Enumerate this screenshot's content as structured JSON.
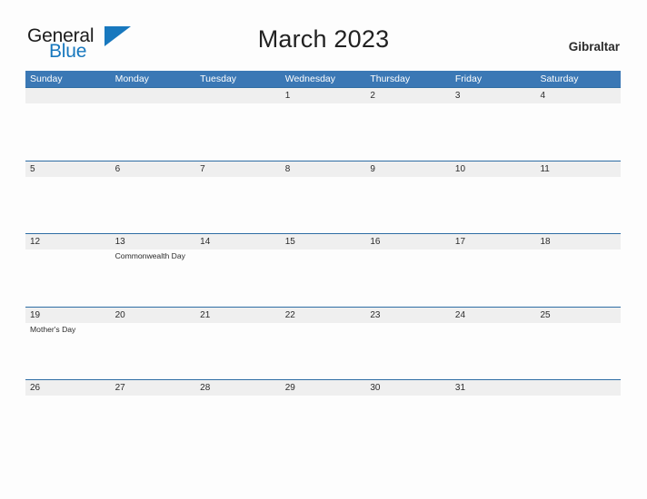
{
  "brand": {
    "name_part1": "General",
    "name_part2": "Blue",
    "flag_icon": "blue-flag-triangle-icon",
    "accent_color": "#1878be"
  },
  "header": {
    "title": "March 2023",
    "country": "Gibraltar"
  },
  "theme": {
    "header_bar_color": "#3b78b5",
    "row_divider_color": "#2e6da4",
    "date_band_color": "#efefef",
    "page_background": "#fdfdfd",
    "text_color": "#2b2b2b"
  },
  "calendar": {
    "month": "March",
    "year": "2023",
    "weekday_headers": [
      "Sunday",
      "Monday",
      "Tuesday",
      "Wednesday",
      "Thursday",
      "Friday",
      "Saturday"
    ],
    "weeks": [
      [
        {
          "day": "",
          "event": ""
        },
        {
          "day": "",
          "event": ""
        },
        {
          "day": "",
          "event": ""
        },
        {
          "day": "1",
          "event": ""
        },
        {
          "day": "2",
          "event": ""
        },
        {
          "day": "3",
          "event": ""
        },
        {
          "day": "4",
          "event": ""
        }
      ],
      [
        {
          "day": "5",
          "event": ""
        },
        {
          "day": "6",
          "event": ""
        },
        {
          "day": "7",
          "event": ""
        },
        {
          "day": "8",
          "event": ""
        },
        {
          "day": "9",
          "event": ""
        },
        {
          "day": "10",
          "event": ""
        },
        {
          "day": "11",
          "event": ""
        }
      ],
      [
        {
          "day": "12",
          "event": ""
        },
        {
          "day": "13",
          "event": "Commonwealth Day"
        },
        {
          "day": "14",
          "event": ""
        },
        {
          "day": "15",
          "event": ""
        },
        {
          "day": "16",
          "event": ""
        },
        {
          "day": "17",
          "event": ""
        },
        {
          "day": "18",
          "event": ""
        }
      ],
      [
        {
          "day": "19",
          "event": "Mother's Day"
        },
        {
          "day": "20",
          "event": ""
        },
        {
          "day": "21",
          "event": ""
        },
        {
          "day": "22",
          "event": ""
        },
        {
          "day": "23",
          "event": ""
        },
        {
          "day": "24",
          "event": ""
        },
        {
          "day": "25",
          "event": ""
        }
      ],
      [
        {
          "day": "26",
          "event": ""
        },
        {
          "day": "27",
          "event": ""
        },
        {
          "day": "28",
          "event": ""
        },
        {
          "day": "29",
          "event": ""
        },
        {
          "day": "30",
          "event": ""
        },
        {
          "day": "31",
          "event": ""
        },
        {
          "day": "",
          "event": ""
        }
      ]
    ]
  }
}
